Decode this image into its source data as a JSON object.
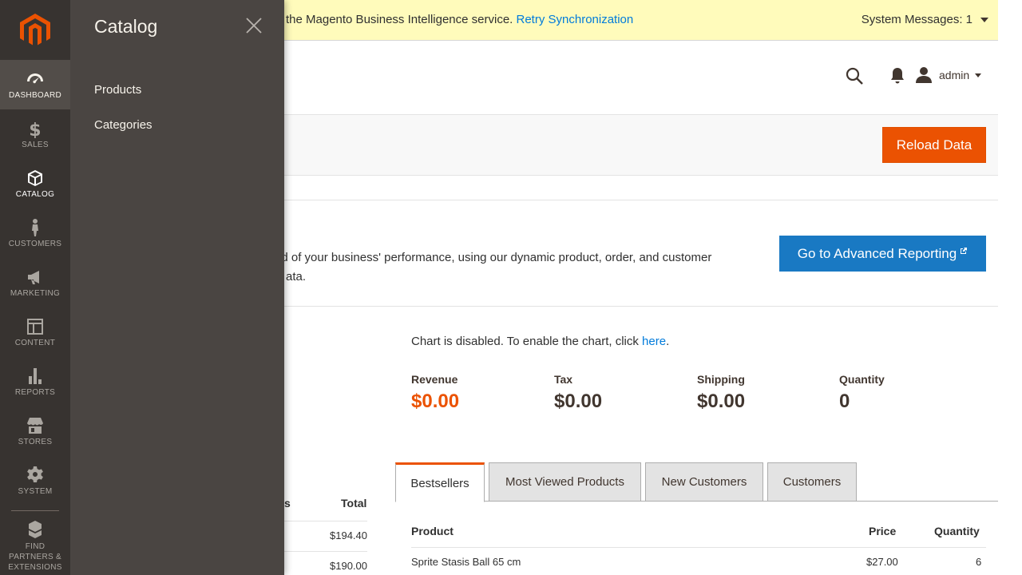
{
  "menu": {
    "items": [
      {
        "label": "DASHBOARD",
        "icon": "dashboard-icon"
      },
      {
        "label": "SALES",
        "icon": "dollar-icon"
      },
      {
        "label": "CATALOG",
        "icon": "box-icon"
      },
      {
        "label": "CUSTOMERS",
        "icon": "person-icon"
      },
      {
        "label": "MARKETING",
        "icon": "megaphone-icon"
      },
      {
        "label": "CONTENT",
        "icon": "layout-icon"
      },
      {
        "label": "REPORTS",
        "icon": "bar-chart-icon"
      },
      {
        "label": "STORES",
        "icon": "store-icon"
      },
      {
        "label": "SYSTEM",
        "icon": "gear-icon"
      }
    ],
    "partners": [
      "FIND",
      "PARTNERS &",
      "EXTENSIONS"
    ]
  },
  "submenu": {
    "title": "Catalog",
    "items": [
      "Products",
      "Categories"
    ]
  },
  "system_bar": {
    "message": "the Magento Business Intelligence service.",
    "link": "Retry Synchronization",
    "count_label": "System Messages: 1"
  },
  "header": {
    "user": "admin"
  },
  "actions": {
    "reload": "Reload Data",
    "advanced": "Go to Advanced Reporting"
  },
  "advanced_text": {
    "line1": "nd of your business' performance, using our dynamic product, order, and customer",
    "line2": "ata."
  },
  "chart": {
    "note": "Chart is disabled. To enable the chart, click ",
    "link": "here",
    "period": "."
  },
  "totals": [
    {
      "label": "Revenue",
      "value": "$0.00"
    },
    {
      "label": "Tax",
      "value": "$0.00"
    },
    {
      "label": "Shipping",
      "value": "$0.00"
    },
    {
      "label": "Quantity",
      "value": "0"
    }
  ],
  "left_table": {
    "col1": "s",
    "col2": "Total",
    "values": [
      "$194.40",
      "$190.00"
    ]
  },
  "tabs": [
    "Bestsellers",
    "Most Viewed Products",
    "New Customers",
    "Customers"
  ],
  "grid": {
    "headers": {
      "product": "Product",
      "price": "Price",
      "quantity": "Quantity"
    },
    "rows": [
      {
        "product": "Sprite Stasis Ball 65 cm",
        "price": "$27.00",
        "quantity": "6"
      }
    ]
  },
  "colors": {
    "accent": "#eb5202",
    "primary_blue": "#1979c3",
    "link": "#007bdb",
    "menu_bg": "#373330",
    "submenu_bg": "#4a4542",
    "notice_bg": "#fffbbb"
  }
}
